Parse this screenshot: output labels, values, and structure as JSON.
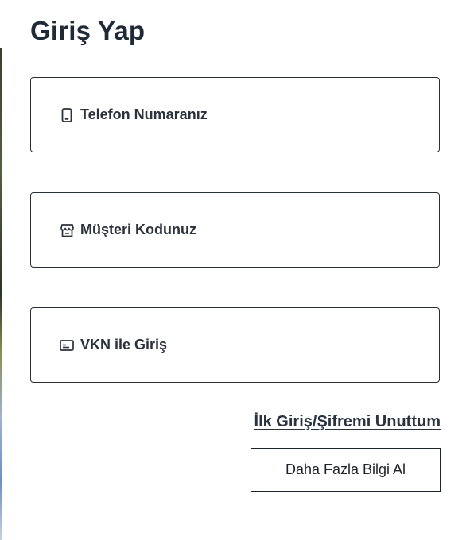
{
  "page": {
    "title": "Giriş Yap"
  },
  "login_options": [
    {
      "label": "Telefon Numaranız",
      "icon": "phone-icon"
    },
    {
      "label": "Müşteri Kodunuz",
      "icon": "store-icon"
    },
    {
      "label": "VKN ile Giriş",
      "icon": "id-card-icon"
    }
  ],
  "links": {
    "forgot_password": "İlk Giriş/Şifremi Unuttum"
  },
  "buttons": {
    "more_info": "Daha Fazla Bilgi Al"
  },
  "colors": {
    "text": "#222a35",
    "border": "#2a2f36",
    "background": "#ffffff"
  }
}
